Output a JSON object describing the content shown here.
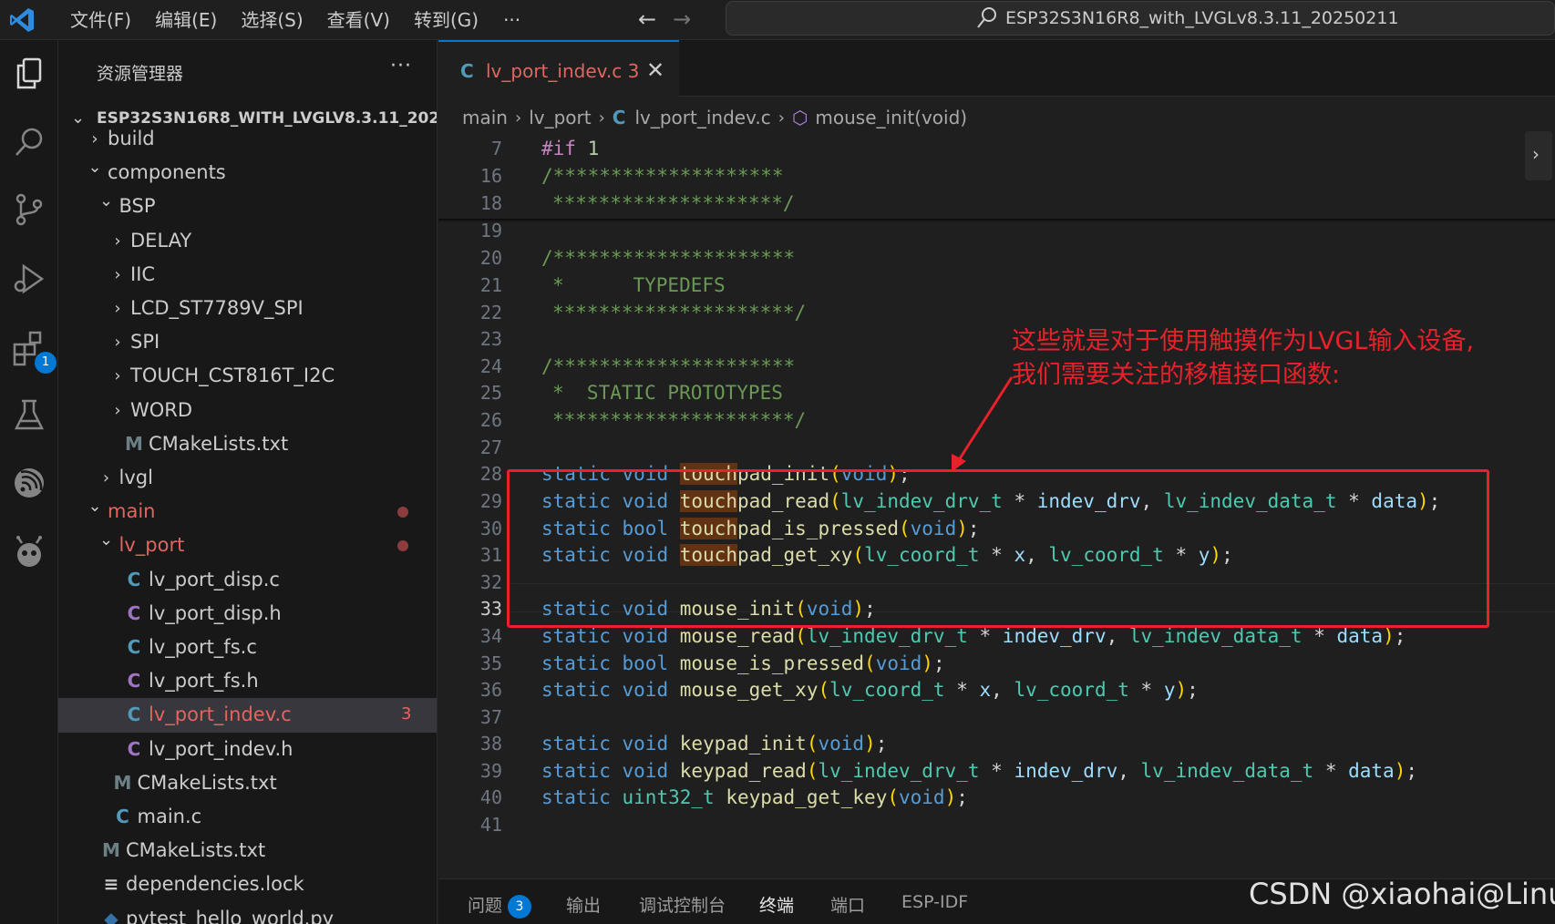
{
  "titlebar": {
    "menus": [
      "文件(F)",
      "编辑(E)",
      "选择(S)",
      "查看(V)",
      "转到(G)",
      "···"
    ],
    "nav_back": "←",
    "nav_forward": "→",
    "command_center": "ESP32S3N16R8_with_LVGLv8.3.11_20250211"
  },
  "activity_bar": {
    "items": [
      "explorer-icon",
      "search-icon",
      "source-control-icon",
      "run-debug-icon",
      "extensions-icon",
      "testing-icon",
      "esp-idf-icon",
      "platformio-icon"
    ],
    "extensions_badge": "1"
  },
  "sidebar": {
    "title": "资源管理器",
    "more": "···",
    "root_label": "ESP32S3N16R8_WITH_LVGLV8.3.11_202...",
    "tree": [
      {
        "label": "build",
        "type": "folder",
        "expanded": false,
        "depth": 0
      },
      {
        "label": "components",
        "type": "folder",
        "expanded": true,
        "depth": 0
      },
      {
        "label": "BSP",
        "type": "folder",
        "expanded": true,
        "depth": 1
      },
      {
        "label": "DELAY",
        "type": "folder",
        "expanded": false,
        "depth": 2
      },
      {
        "label": "IIC",
        "type": "folder",
        "expanded": false,
        "depth": 2
      },
      {
        "label": "LCD_ST7789V_SPI",
        "type": "folder",
        "expanded": false,
        "depth": 2
      },
      {
        "label": "SPI",
        "type": "folder",
        "expanded": false,
        "depth": 2
      },
      {
        "label": "TOUCH_CST816T_I2C",
        "type": "folder",
        "expanded": false,
        "depth": 2
      },
      {
        "label": "WORD",
        "type": "folder",
        "expanded": false,
        "depth": 2
      },
      {
        "label": "CMakeLists.txt",
        "type": "cmake",
        "depth": 2
      },
      {
        "label": "lvgl",
        "type": "folder",
        "expanded": false,
        "depth": 1
      },
      {
        "label": "main",
        "type": "folder",
        "expanded": true,
        "depth": 0,
        "modified": true
      },
      {
        "label": "lv_port",
        "type": "folder",
        "expanded": true,
        "depth": 1,
        "modified": true
      },
      {
        "label": "lv_port_disp.c",
        "type": "c",
        "depth": 2
      },
      {
        "label": "lv_port_disp.h",
        "type": "h",
        "depth": 2
      },
      {
        "label": "lv_port_fs.c",
        "type": "c",
        "depth": 2
      },
      {
        "label": "lv_port_fs.h",
        "type": "h",
        "depth": 2
      },
      {
        "label": "lv_port_indev.c",
        "type": "c",
        "depth": 2,
        "selected": true,
        "problems": "3"
      },
      {
        "label": "lv_port_indev.h",
        "type": "h",
        "depth": 2
      },
      {
        "label": "CMakeLists.txt",
        "type": "cmake",
        "depth": 1
      },
      {
        "label": "main.c",
        "type": "c",
        "depth": 1
      },
      {
        "label": "CMakeLists.txt",
        "type": "cmake",
        "depth": 0
      },
      {
        "label": "dependencies.lock",
        "type": "lock",
        "depth": 0
      },
      {
        "label": "pytest_hello_world.py",
        "type": "py",
        "depth": 0
      }
    ]
  },
  "editor": {
    "tab": {
      "icon": "C",
      "label": "lv_port_indev.c",
      "problems": "3",
      "close": "✕"
    },
    "breadcrumb": [
      "main",
      "lv_port",
      "lv_port_indev.c",
      "mouse_init(void)"
    ],
    "lines": [
      {
        "n": "7"
      },
      {
        "n": "16"
      },
      {
        "n": "18"
      },
      {
        "n": "19"
      },
      {
        "n": "20"
      },
      {
        "n": "21"
      },
      {
        "n": "22"
      },
      {
        "n": "23"
      },
      {
        "n": "24"
      },
      {
        "n": "25"
      },
      {
        "n": "26"
      },
      {
        "n": "27"
      },
      {
        "n": "28"
      },
      {
        "n": "29"
      },
      {
        "n": "30"
      },
      {
        "n": "31"
      },
      {
        "n": "32"
      },
      {
        "n": "33"
      },
      {
        "n": "34"
      },
      {
        "n": "35"
      },
      {
        "n": "36"
      },
      {
        "n": "37"
      },
      {
        "n": "38"
      },
      {
        "n": "39"
      },
      {
        "n": "40"
      },
      {
        "n": "41"
      }
    ],
    "code": {
      "if1": "#if 1",
      "stars_open": "/********************",
      "stars_close": "********************/",
      "star_open_long": "/*********************",
      "star_close_long": "*********************/",
      "typedefs": "*      TYPEDEFS",
      "static_prototypes": "*  STATIC PROTOTYPES"
    }
  },
  "annotation": {
    "line1": "这些就是对于使用触摸作为LVGL输入设备,",
    "line2": "我们需要关注的移植接口函数:",
    "color": "#e8212b"
  },
  "panel": {
    "tabs": [
      "问题",
      "输出",
      "调试控制台",
      "终端",
      "端口",
      "ESP-IDF"
    ],
    "problems_badge": "3",
    "active": "终端"
  },
  "watermark": "CSDN @xiaohai@Linux"
}
